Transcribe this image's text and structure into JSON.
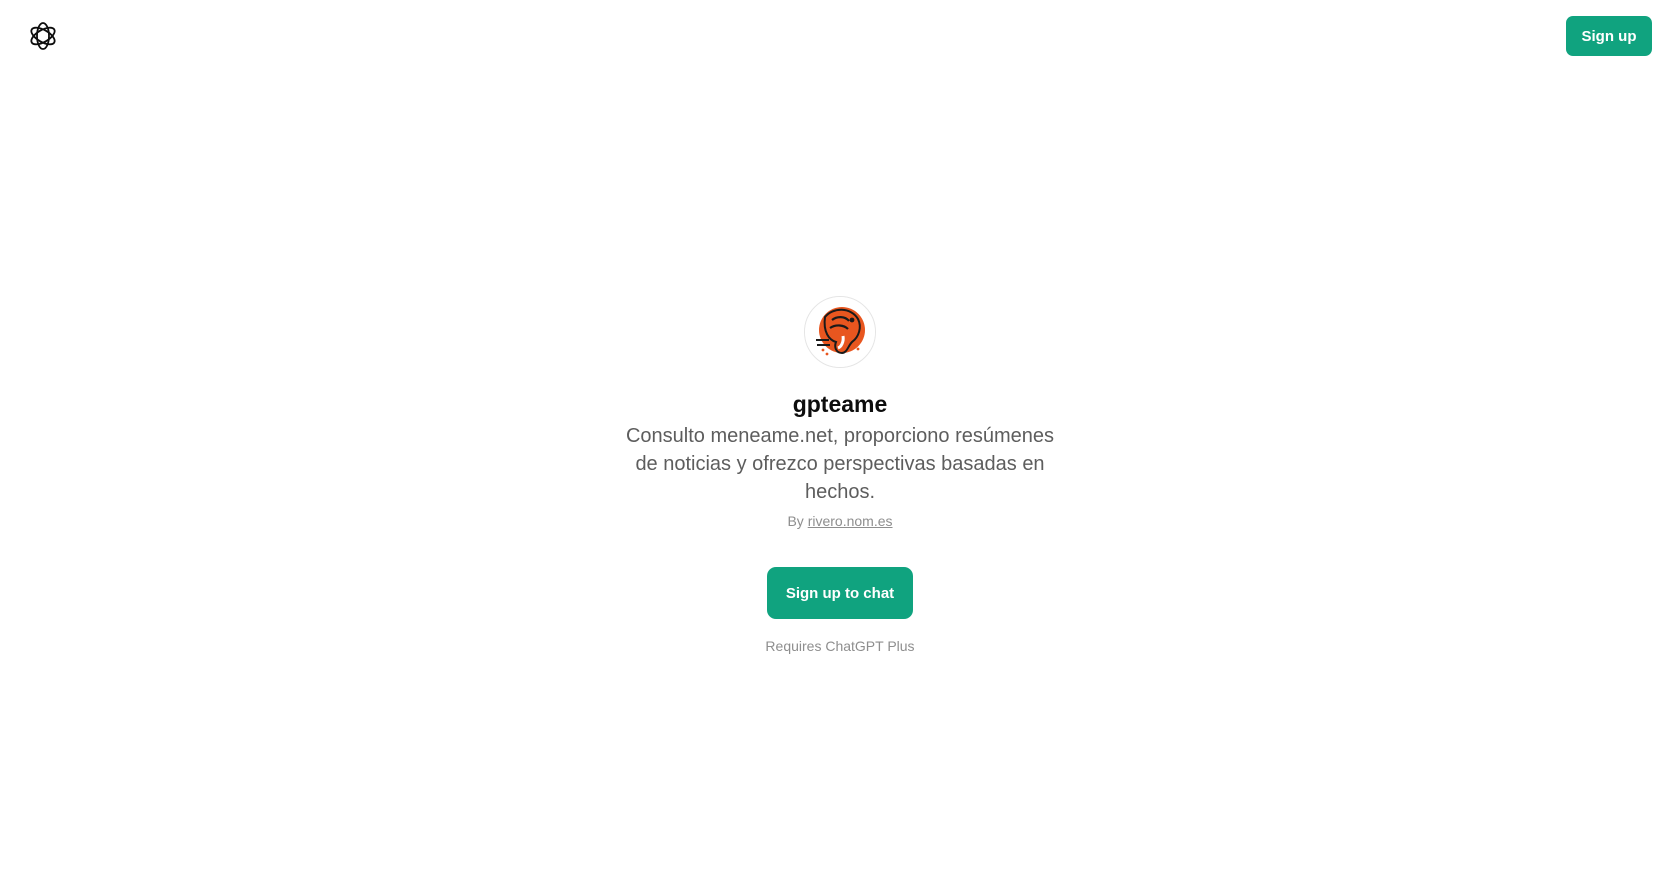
{
  "header": {
    "logo_icon": "openai-logo-icon",
    "signup_label": "Sign up"
  },
  "gpt": {
    "avatar_icon": "orange-elephant-avatar-icon",
    "name": "gpteame",
    "description": "Consulto meneame.net, proporciono resúmenes de noticias y ofrezco perspectivas basadas en hechos.",
    "by_prefix": "By",
    "author": "rivero.nom.es",
    "cta_label": "Sign up to chat",
    "requirement": "Requires ChatGPT Plus"
  },
  "colors": {
    "accent": "#10a37f",
    "avatar_orange": "#e8561f"
  }
}
